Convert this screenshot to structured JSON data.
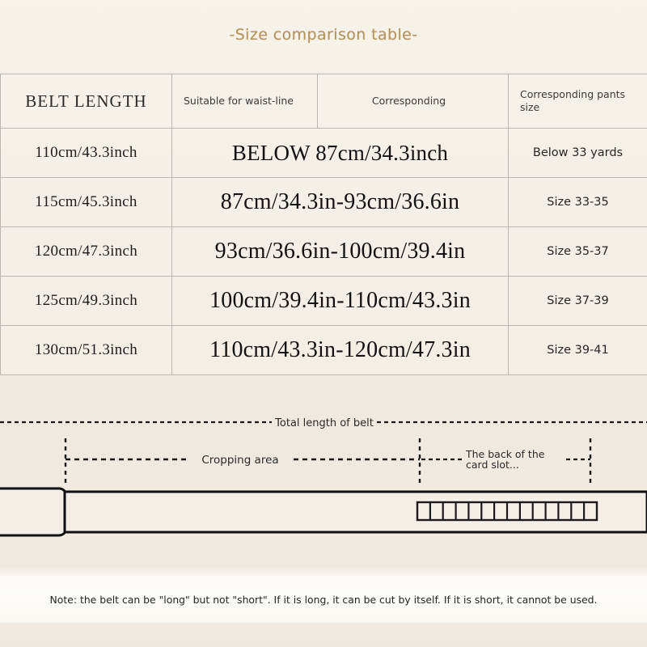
{
  "title": "-Size comparison table-",
  "table": {
    "headers": {
      "belt_length": "BELT  LENGTH",
      "waistline": "Suitable for waist-line",
      "corresponding": "Corresponding",
      "pants_size": "Corresponding pants size"
    },
    "rows": [
      {
        "belt_length": "110cm/43.3inch",
        "waistline": "BELOW  87cm/34.3inch",
        "pants_size": "Below 33 yards"
      },
      {
        "belt_length": "115cm/45.3inch",
        "waistline": "87cm/34.3in-93cm/36.6in",
        "pants_size": "Size 33-35"
      },
      {
        "belt_length": "120cm/47.3inch",
        "waistline": "93cm/36.6in-100cm/39.4in",
        "pants_size": "Size 35-37"
      },
      {
        "belt_length": "125cm/49.3inch",
        "waistline": "100cm/39.4in-110cm/43.3in",
        "pants_size": "Size 37-39"
      },
      {
        "belt_length": "130cm/51.3inch",
        "waistline": "110cm/43.3in-120cm/47.3in",
        "pants_size": "Size 39-41"
      }
    ]
  },
  "diagram": {
    "total_length_label": "Total length of belt",
    "cropping_area_label": "Cropping area",
    "card_slot_label": "The back of the card slot...",
    "card_slot_segments": 14
  },
  "note": "Note: the belt can be \"long\" but not \"short\". If it is long, it can be cut by itself. If it is short, it cannot be used.",
  "colors": {
    "title": "#b3935f",
    "background": "#f3eee4",
    "table_border": "#b9b7b2",
    "ink": "#1d1d1d"
  }
}
